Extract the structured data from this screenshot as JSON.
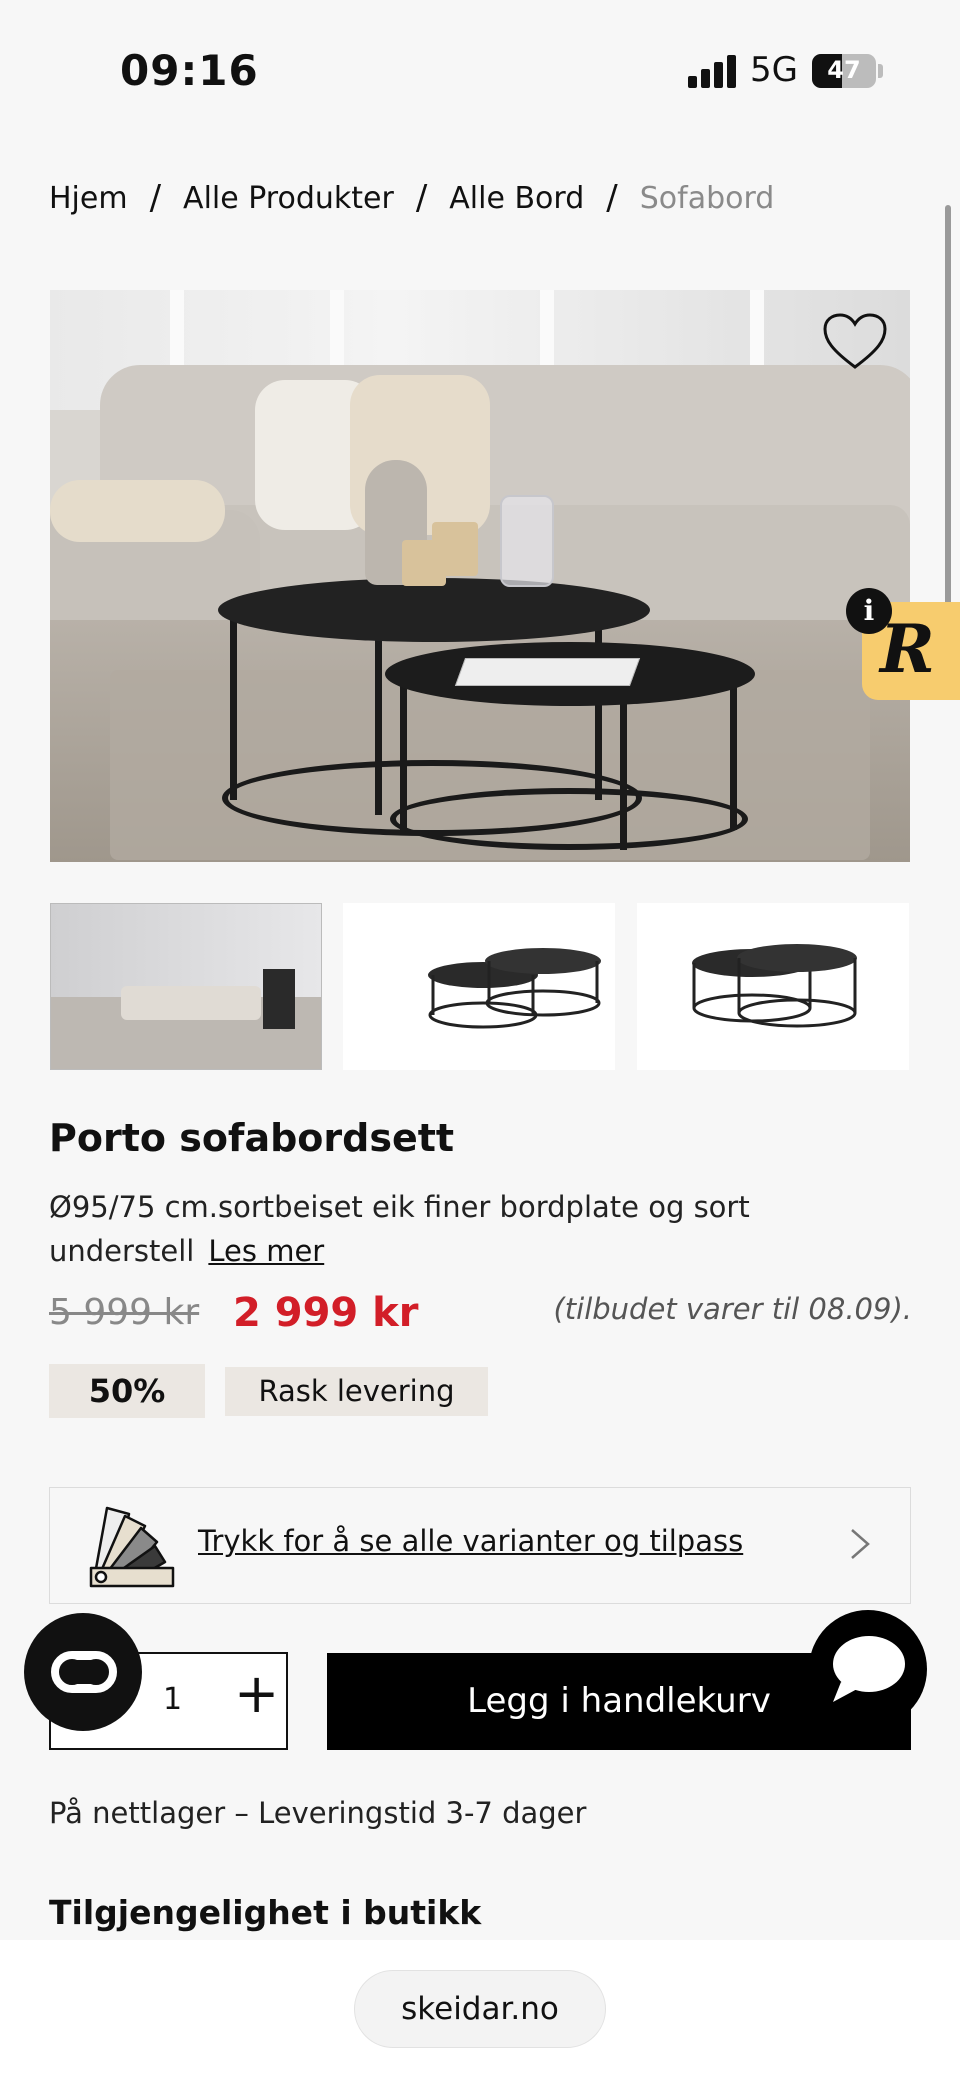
{
  "status_bar": {
    "time": "09:16",
    "network": "5G",
    "battery": "47",
    "battery_level": 0.47
  },
  "breadcrumb": {
    "items": [
      "Hjem",
      "Alle Produkter",
      "Alle Bord"
    ],
    "separator": "/",
    "current": "Sofabord"
  },
  "badge": {
    "info_glyph": "i",
    "letter": "R"
  },
  "product": {
    "title": "Porto sofabordsett",
    "description": "Ø95/75 cm.sortbeiset eik finer bordplate og sort understell",
    "read_more": "Les mer",
    "old_price": "5 999 kr",
    "new_price": "2 999 kr",
    "offer_note": "(tilbudet varer til 08.09).",
    "discount_tag": "50%",
    "delivery_tag": "Rask levering"
  },
  "variants": {
    "label": "Trykk for å se alle varianter og tilpass"
  },
  "cart": {
    "quantity": "1",
    "plus": "+",
    "add_label": "Legg i handlekurv"
  },
  "stock_text": "På nettlager – Leveringstid 3-7 dager",
  "availability_title": "Tilgjengelighet i butikk",
  "browser": {
    "url": "skeidar.no"
  },
  "colors": {
    "price_red": "#d21e28",
    "badge_yellow": "#f7cc6e",
    "tag_bg": "#ebe7e2"
  }
}
